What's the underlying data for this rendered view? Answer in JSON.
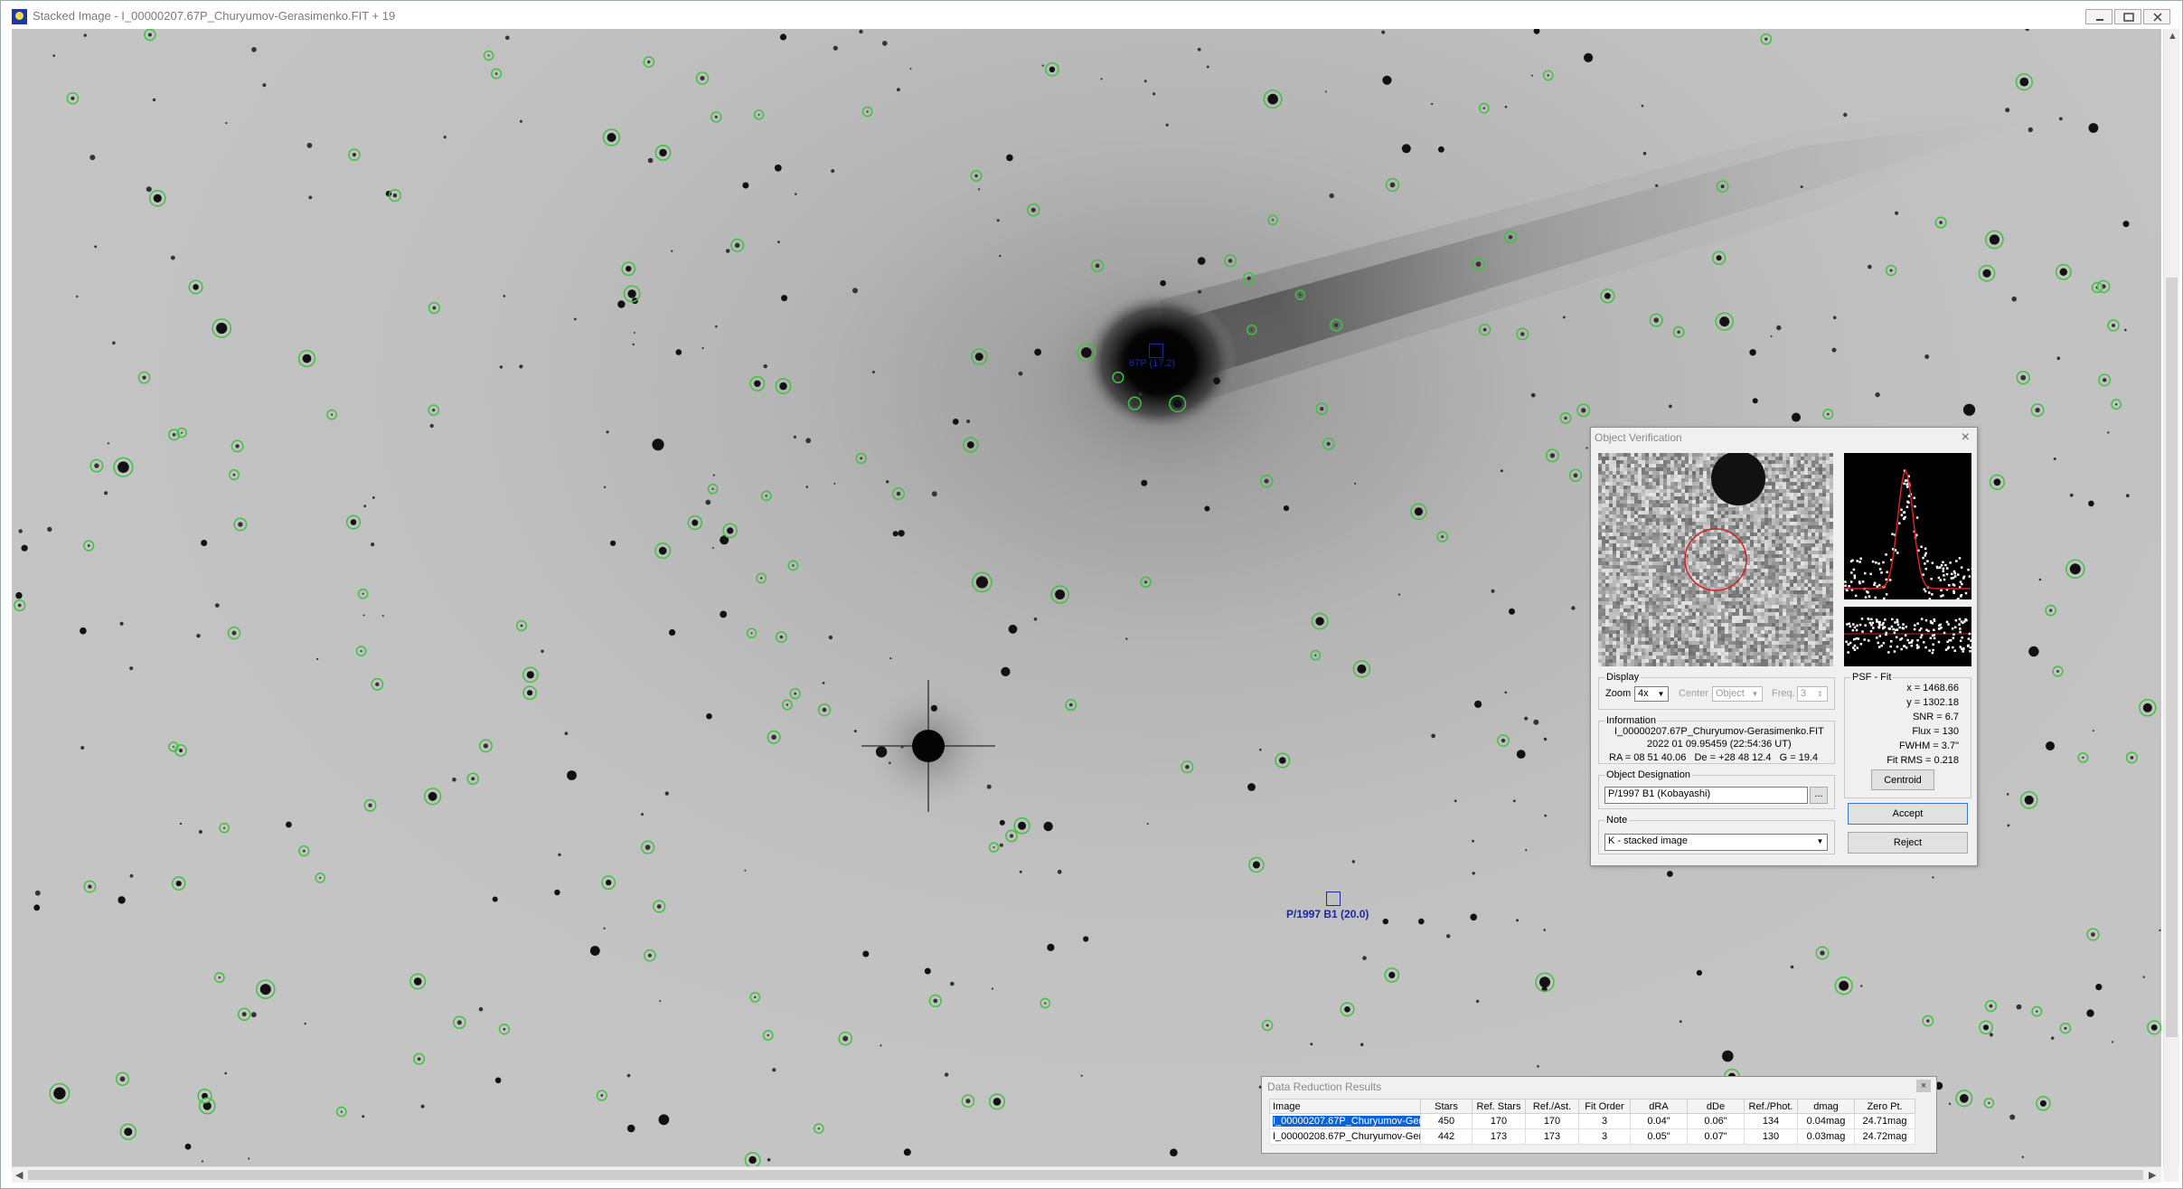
{
  "window": {
    "title": "Stacked Image - I_00000207.67P_Churyumov-Gerasimenko.FIT + 19",
    "app_icon": "astrometrica-icon"
  },
  "image_labels": {
    "comet_label": "67P (17.2)",
    "target_label": "P/1997 B1 (20.0)"
  },
  "verification_dialog": {
    "title": "Object Verification",
    "display": {
      "legend": "Display",
      "zoom_label": "Zoom",
      "zoom_value": "4x",
      "center_label": "Center",
      "center_value": "Object",
      "freq_label": "Freq.",
      "freq_value": "3"
    },
    "information": {
      "legend": "Information",
      "filename": "I_00000207.67P_Churyumov-Gerasimenko.FIT",
      "datetime": "2022 01 09.95459 (22:54:36 UT)",
      "coords": "RA = 08 51 40.06   De = +28 48 12.4   G = 19.4"
    },
    "designation": {
      "legend": "Object Designation",
      "value": "P/1997 B1 (Kobayashi)",
      "browse_label": "..."
    },
    "note": {
      "legend": "Note",
      "value": "K - stacked image"
    },
    "psf_fit": {
      "legend": "PSF - Fit",
      "x": "x = 1468.66",
      "y": "y = 1302.18",
      "snr": "SNR = 6.7",
      "flux": "Flux = 130",
      "fwhm": "FWHM = 3.7\"",
      "fit_rms": "Fit RMS = 0.218",
      "centroid_label": "Centroid"
    },
    "accept_label": "Accept",
    "reject_label": "Reject"
  },
  "results": {
    "title": "Data Reduction Results",
    "columns": [
      "Image",
      "Stars",
      "Ref. Stars",
      "Ref./Ast.",
      "Fit Order",
      "dRA",
      "dDe",
      "Ref./Phot.",
      "dmag",
      "Zero Pt."
    ],
    "rows": [
      [
        "I_00000207.67P_Churyumov-Ger",
        "450",
        "170",
        "170",
        "3",
        "0.04\"",
        "0.06\"",
        "134",
        "0.04mag",
        "24.71mag"
      ],
      [
        "I_00000208.67P_Churyumov-Ger",
        "442",
        "173",
        "173",
        "3",
        "0.05\"",
        "0.07\"",
        "130",
        "0.03mag",
        "24.72mag"
      ]
    ]
  }
}
